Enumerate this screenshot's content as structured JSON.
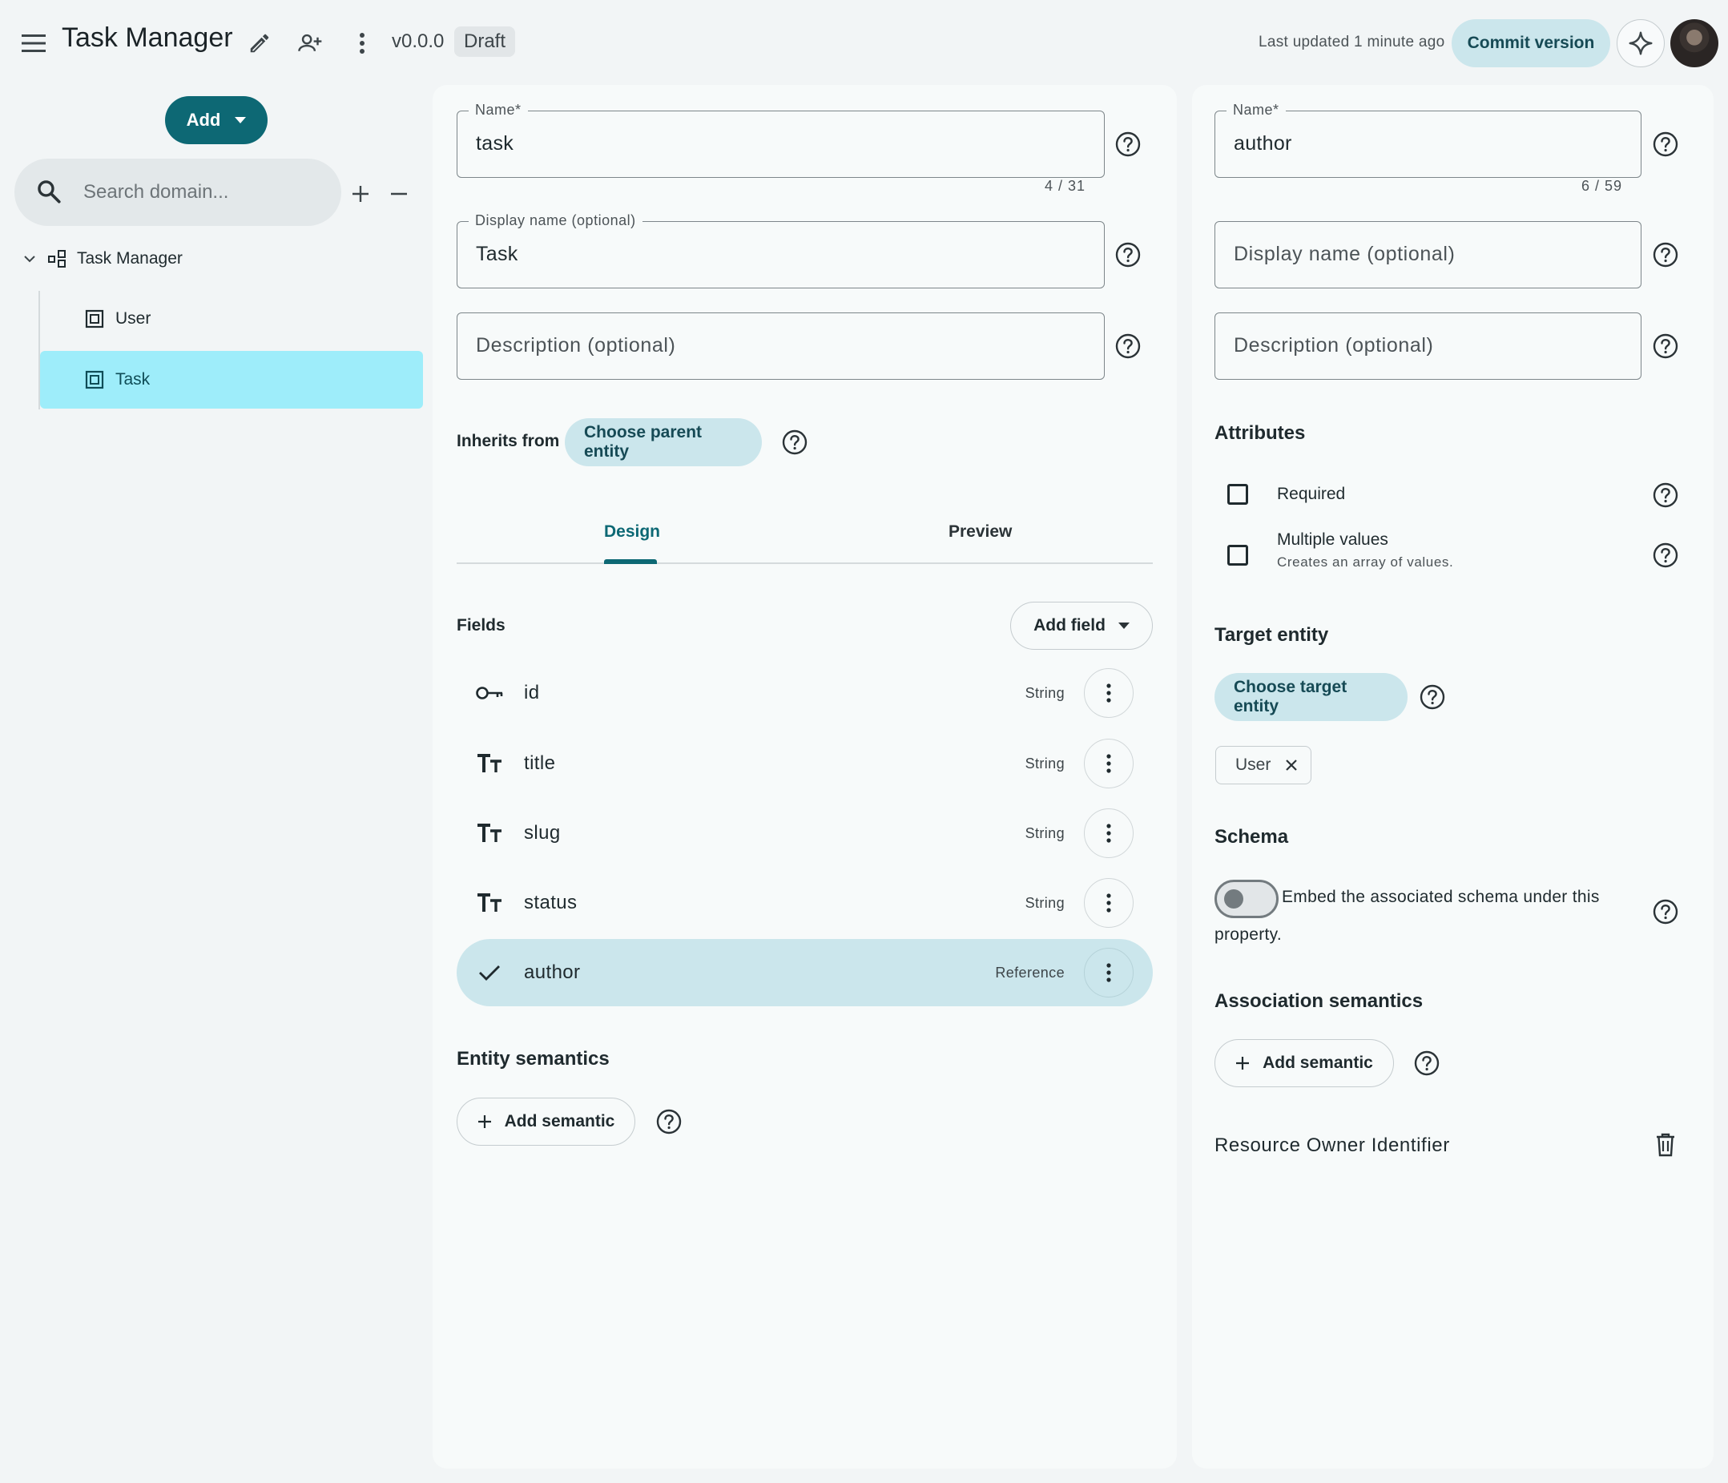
{
  "topbar": {
    "title": "Task Manager",
    "version": "v0.0.0",
    "status": "Draft",
    "last_updated": "Last updated 1 minute ago",
    "commit_label": "Commit version",
    "icons": [
      "menu-icon",
      "edit-icon",
      "add-person-icon",
      "more-vert-icon",
      "sparkle-icon"
    ]
  },
  "sidebar": {
    "add_label": "Add",
    "search_placeholder": "Search domain...",
    "root": {
      "label": "Task Manager"
    },
    "items": [
      {
        "label": "User",
        "selected": false
      },
      {
        "label": "Task",
        "selected": true
      }
    ]
  },
  "entity": {
    "name_label": "Name*",
    "name_value": "task",
    "name_counter": "4 / 31",
    "display_label": "Display name (optional)",
    "display_value": "Task",
    "description_placeholder": "Description (optional)",
    "inherits_label": "Inherits from",
    "parent_button": "Choose parent entity",
    "tabs": [
      {
        "label": "Design",
        "active": true
      },
      {
        "label": "Preview",
        "active": false
      }
    ],
    "fields_title": "Fields",
    "add_field_label": "Add field",
    "fields": [
      {
        "name": "id",
        "type": "String",
        "icon": "key-icon",
        "selected": false
      },
      {
        "name": "title",
        "type": "String",
        "icon": "text-type-icon",
        "selected": false
      },
      {
        "name": "slug",
        "type": "String",
        "icon": "text-type-icon",
        "selected": false
      },
      {
        "name": "status",
        "type": "String",
        "icon": "text-type-icon",
        "selected": false
      },
      {
        "name": "author",
        "type": "Reference",
        "icon": "check-icon",
        "selected": true
      }
    ],
    "semantics_title": "Entity semantics",
    "add_semantic_label": "Add semantic"
  },
  "property": {
    "name_label": "Name*",
    "name_value": "author",
    "name_counter": "6 / 59",
    "display_placeholder": "Display name (optional)",
    "description_placeholder": "Description (optional)",
    "attributes_title": "Attributes",
    "required_label": "Required",
    "multiple_label": "Multiple values",
    "multiple_sub": "Creates an array of values.",
    "target_title": "Target entity",
    "target_button": "Choose target entity",
    "target_chip": "User",
    "schema_title": "Schema",
    "embed_text_1": "Embed the associated schema under this",
    "embed_text_2": "property.",
    "embed_enabled": false,
    "assoc_title": "Association semantics",
    "add_semantic_label": "Add semantic",
    "semantic_item": "Resource Owner Identifier"
  },
  "colors": {
    "primary": "#0d6874",
    "tonal": "#cbe6ec",
    "selected_tree": "#9eedfa",
    "background": "#f2f5f6",
    "panel": "#f7fafa"
  }
}
